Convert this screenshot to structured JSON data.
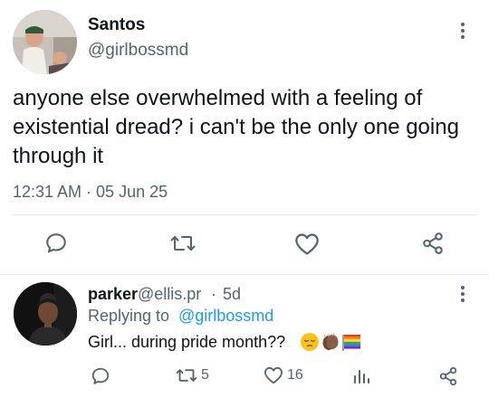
{
  "tweet": {
    "author_name": "Santos",
    "author_handle": "@girlbossmd",
    "text": "anyone else overwhelmed with a feeling of existential dread? i can't be the only one going through it",
    "timestamp": "12:31 AM · 05 Jun 25",
    "actions": [
      {
        "name": "reply",
        "icon": "speech-bubble-icon"
      },
      {
        "name": "retweet",
        "icon": "retweet-icon"
      },
      {
        "name": "like",
        "icon": "heart-icon"
      },
      {
        "name": "share",
        "icon": "share-icon"
      }
    ]
  },
  "reply": {
    "author_name": "parker",
    "author_handle": "@ellis.pr",
    "separator": "·",
    "time": "5d",
    "replying_prefix": "Replying to",
    "replying_to": "@girlbossmd",
    "text": "Girl... during pride month??",
    "emojis": [
      "pensive-face-emoji",
      "clapping-hands-dark-skin-emoji",
      "rainbow-flag-emoji"
    ],
    "retweet_count": "5",
    "like_count": "16"
  },
  "colors": {
    "text": "#0f1419",
    "secondary": "#536471",
    "link": "#1d9bf0",
    "divider": "#e1e8ed"
  }
}
